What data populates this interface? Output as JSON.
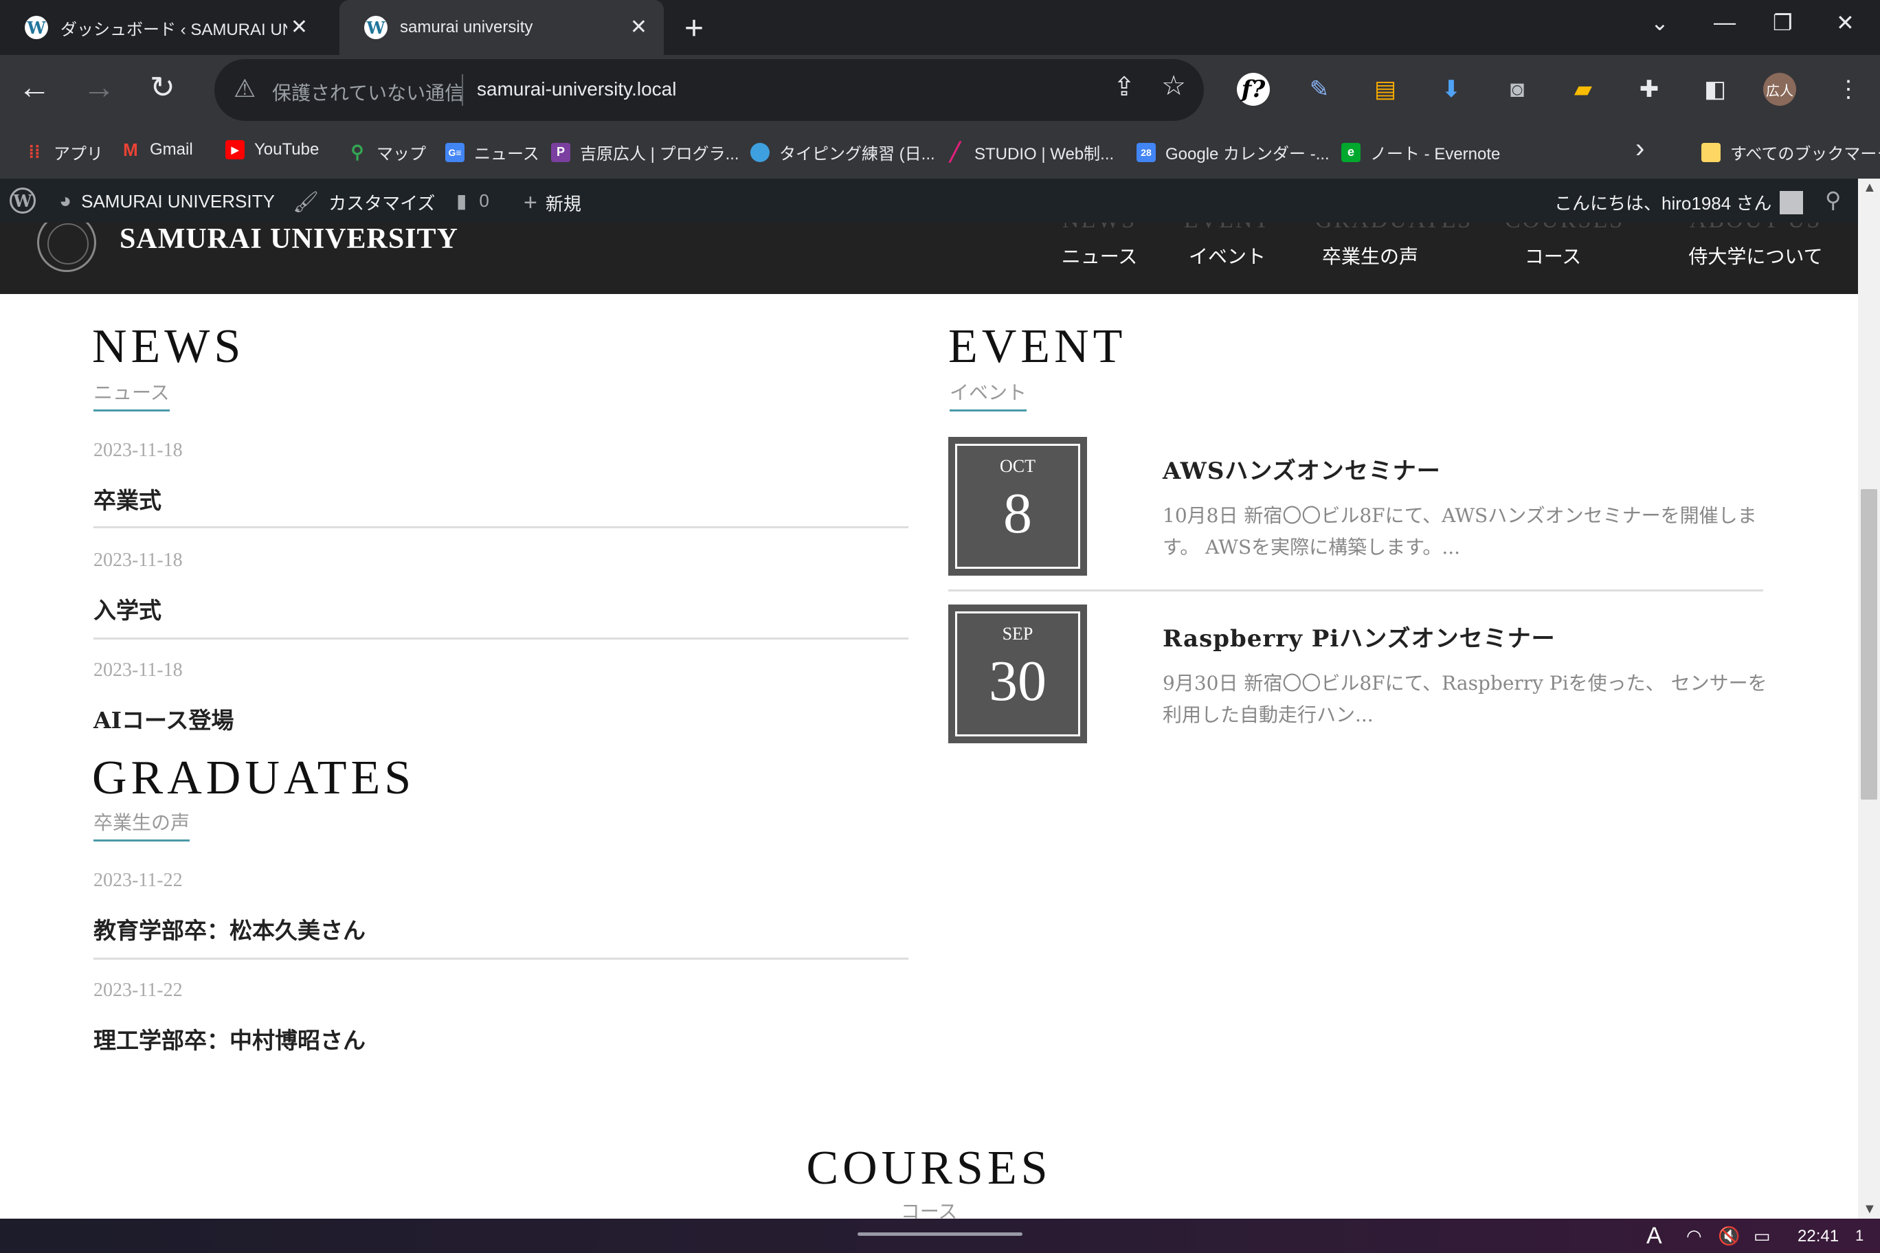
{
  "browser": {
    "tabs": [
      {
        "title": "ダッシュボード ‹ SAMURAI UNIVERSITY",
        "active": false
      },
      {
        "title": "samurai university",
        "active": true
      }
    ],
    "new_tab": "+",
    "window_controls": {
      "dropdown": "⌄",
      "minimize": "—",
      "restore": "❐",
      "close": "✕"
    },
    "omnibox": {
      "security_text": "保護されていない通信",
      "url": "samurai-university.local"
    },
    "profile_label": "広人",
    "bookmarks": [
      {
        "label": "アプリ",
        "icon": "apps-grid-icon",
        "color": "#ea4335"
      },
      {
        "label": "Gmail",
        "icon": "gmail-icon",
        "color": "#ea4335"
      },
      {
        "label": "YouTube",
        "icon": "youtube-icon",
        "color": "#ff0000"
      },
      {
        "label": "マップ",
        "icon": "maps-pin-icon",
        "color": "#34a853"
      },
      {
        "label": "ニュース",
        "icon": "google-news-icon",
        "color": "#4285f4"
      },
      {
        "label": "吉原広人 | プログラ...",
        "icon": "portfolio-icon",
        "color": "#7b3fa0"
      },
      {
        "label": "タイピング練習 (日...",
        "icon": "typing-icon",
        "color": "#3fa0e0"
      },
      {
        "label": "STUDIO | Web制...",
        "icon": "studio-icon",
        "color": "#e0207a"
      },
      {
        "label": "Google カレンダー -...",
        "icon": "calendar-icon",
        "color": "#4285f4"
      },
      {
        "label": "ノート - Evernote",
        "icon": "evernote-icon",
        "color": "#00a82d"
      }
    ],
    "bookmarks_more": "›",
    "all_bookmarks": "すべてのブックマーク"
  },
  "admin_bar": {
    "site_name": "SAMURAI UNIVERSITY",
    "customize": "カスタマイズ",
    "comments_count": "0",
    "new": "新規",
    "greeting": "こんにちは、hiro1984 さん"
  },
  "site_header": {
    "site_name": "SAMURAI UNIVERSITY",
    "nav": [
      {
        "en": "NEWS",
        "ja": "ニュース"
      },
      {
        "en": "EVENT",
        "ja": "イベント"
      },
      {
        "en": "GRADUATES",
        "ja": "卒業生の声"
      },
      {
        "en": "COURSES",
        "ja": "コース"
      },
      {
        "en": "ABOUT US",
        "ja": "侍大学について"
      }
    ]
  },
  "news": {
    "title_en": "NEWS",
    "title_ja": "ニュース",
    "posts": [
      {
        "date": "2023-11-18",
        "title": "卒業式"
      },
      {
        "date": "2023-11-18",
        "title": "入学式"
      },
      {
        "date": "2023-11-18",
        "title": "AIコース登場"
      }
    ]
  },
  "graduates": {
    "title_en": "GRADUATES",
    "title_ja": "卒業生の声",
    "posts": [
      {
        "date": "2023-11-22",
        "title": "教育学部卒：松本久美さん"
      },
      {
        "date": "2023-11-22",
        "title": "理工学部卒：中村博昭さん"
      }
    ]
  },
  "event": {
    "title_en": "EVENT",
    "title_ja": "イベント",
    "items": [
      {
        "month": "OCT",
        "day": "8",
        "title": "AWSハンズオンセミナー",
        "desc": "10月8日 新宿〇〇ビル8Fにて、AWSハンズオンセミナーを開催します。 AWSを実際に構築します。..."
      },
      {
        "month": "SEP",
        "day": "30",
        "title": "Raspberry Piハンズオンセミナー",
        "desc": "9月30日 新宿〇〇ビル8Fにて、Raspberry Piを使った、 センサーを利用した自動走行ハン..."
      }
    ]
  },
  "courses": {
    "title_en": "COURSES",
    "title_ja": "コース"
  },
  "taskbar": {
    "ime": "A",
    "clock": "22:41"
  }
}
